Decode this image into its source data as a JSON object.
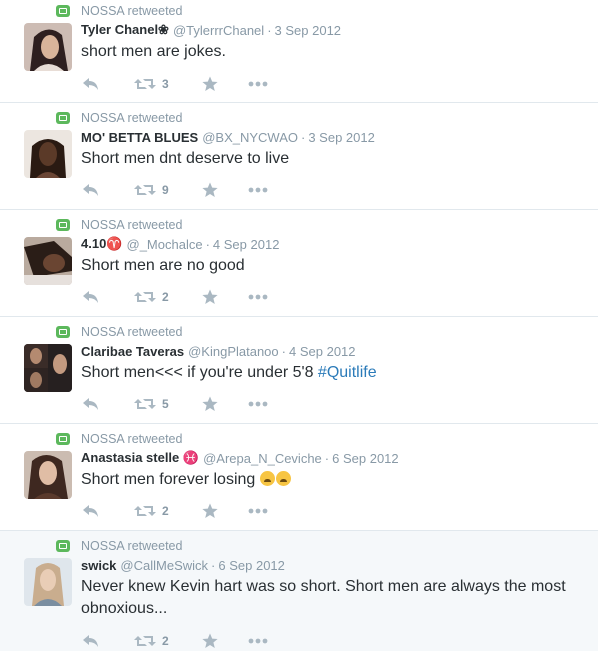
{
  "tweets": [
    {
      "retweeted_by": "NOSSA retweeted",
      "name": "Tyler Chanel❀",
      "handle": "@TylerrrChanel",
      "date": "3 Sep 2012",
      "text": "short men are jokes.",
      "retweet_count": "3",
      "avatar_colors": [
        "#c9b7b0",
        "#3a2a2a"
      ]
    },
    {
      "retweeted_by": "NOSSA retweeted",
      "name": "MO' BETTA BLUES",
      "handle": "@BX_NYCWAO",
      "date": "3 Sep 2012",
      "text": "Short men dnt deserve to live",
      "retweet_count": "9",
      "avatar_colors": [
        "#e8e2dc",
        "#3b2416"
      ]
    },
    {
      "retweeted_by": "NOSSA retweeted",
      "name": "4.10♈",
      "handle": "@_Mochalce",
      "date": "4 Sep 2012",
      "text": "Short men are no good",
      "retweet_count": "2",
      "avatar_colors": [
        "#b8a79a",
        "#2a1d17"
      ]
    },
    {
      "retweeted_by": "NOSSA retweeted",
      "name": "Claribae Taveras",
      "handle": "@KingPlatanoo",
      "date": "4 Sep 2012",
      "text_prefix": "Short men<<< if you're under 5'8 ",
      "hashtag": "#Quitlife",
      "retweet_count": "5",
      "avatar_colors": [
        "#1d1a1a",
        "#a7826b"
      ]
    },
    {
      "retweeted_by": "NOSSA retweeted",
      "name": "Anastasia stelle ♓",
      "handle": "@Arepa_N_Ceviche",
      "date": "6 Sep 2012",
      "text": "Short men forever losing ",
      "retweet_count": "2",
      "avatar_colors": [
        "#c7b7ab",
        "#4a2f23"
      ]
    },
    {
      "retweeted_by": "NOSSA retweeted",
      "name": "swick",
      "handle": "@CallMeSwick",
      "date": "6 Sep 2012",
      "text": "Never knew Kevin hart was so short. Short men are always the most obnoxious...",
      "retweet_count": "2",
      "avatar_colors": [
        "#d9e2ea",
        "#d8b79b"
      ]
    }
  ],
  "colors": {
    "retweet_green": "#5cb85c",
    "muted_text": "#8899a6",
    "hashtag_blue": "#2b7bb9",
    "highlight_bg": "#f5f8fa",
    "icons": "#aab8c2"
  }
}
